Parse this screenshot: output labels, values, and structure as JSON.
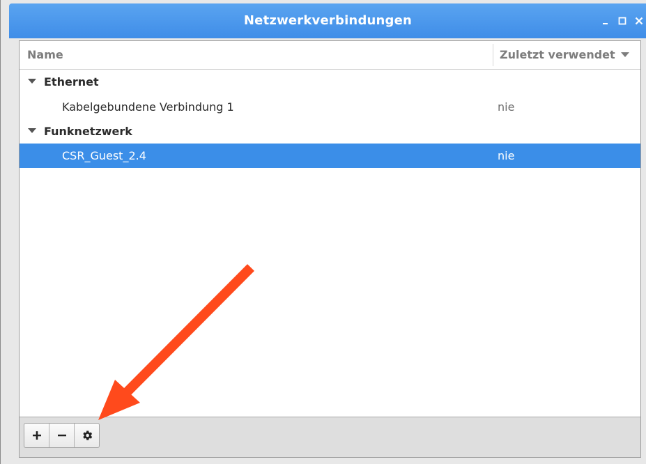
{
  "window": {
    "title": "Netzwerkverbindungen",
    "controls": [
      "minimize-icon",
      "maximize-icon",
      "close-icon"
    ]
  },
  "columns": {
    "name": "Name",
    "last_used": "Zuletzt verwendet",
    "sort_icon": "chevron-down-icon"
  },
  "groups": [
    {
      "label": "Ethernet",
      "expanded": true,
      "items": [
        {
          "name": "Kabelgebundene Verbindung 1",
          "last_used": "nie",
          "selected": false
        }
      ]
    },
    {
      "label": "Funknetzwerk",
      "expanded": true,
      "items": [
        {
          "name": "CSR_Guest_2.4",
          "last_used": "nie",
          "selected": true
        }
      ]
    }
  ],
  "toolbar": {
    "buttons": [
      "add-icon",
      "remove-icon",
      "gear-icon"
    ]
  },
  "annotation": {
    "color": "#ff4a1c",
    "points_to": "gear-icon"
  },
  "colors": {
    "titlebar": "#4a97ec",
    "selection": "#3b8ee8"
  }
}
